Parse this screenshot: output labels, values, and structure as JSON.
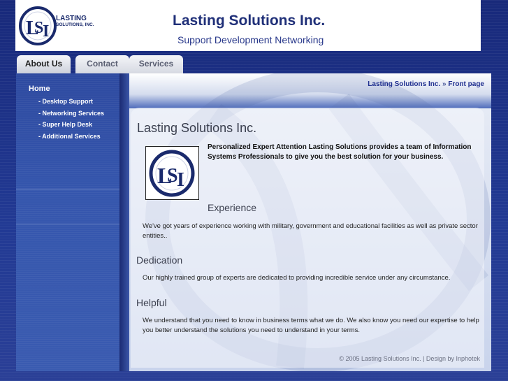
{
  "header": {
    "logo_name": "LASTING",
    "logo_sub": "SOLUTIONS, INC.",
    "title": "Lasting Solutions Inc.",
    "subtitle": "Support Development Networking"
  },
  "tabs": [
    {
      "label": "About Us",
      "active": true
    },
    {
      "label": "Contact",
      "active": false
    },
    {
      "label": "Services",
      "active": false
    }
  ],
  "sidebar": {
    "home": "Home",
    "links": [
      {
        "label": "- Desktop Support"
      },
      {
        "label": "- Networking Services"
      },
      {
        "label": "- Super Help Desk"
      },
      {
        "label": "- Additional Services"
      }
    ]
  },
  "breadcrumb": {
    "site": "Lasting Solutions Inc.",
    "separator": "»",
    "page": "Front page"
  },
  "content": {
    "title": "Lasting Solutions Inc.",
    "intro": "Personalized Expert Attention Lasting Solutions provides a team of Information Systems Professionals to give you the best solution for your business.",
    "sections": [
      {
        "heading": "Experience",
        "text": "We've got years of experience working with military, government and educational facilities as well as private sector entities.."
      },
      {
        "heading": "Dedication",
        "text": "Our highly trained group of experts are dedicated to providing incredible service under any circumstance."
      },
      {
        "heading": "Helpful",
        "text": "We understand that you need to know in business terms what we do. We also know you need our expertise to help you better understand the solutions you need to understand in your terms."
      }
    ]
  },
  "footer": {
    "text": "© 2005 Lasting Solutions Inc. | Design by Inphotek"
  },
  "colors": {
    "brand_navy": "#1f2f78",
    "background": "#1c2f82",
    "sidebar": "#3556ad"
  }
}
